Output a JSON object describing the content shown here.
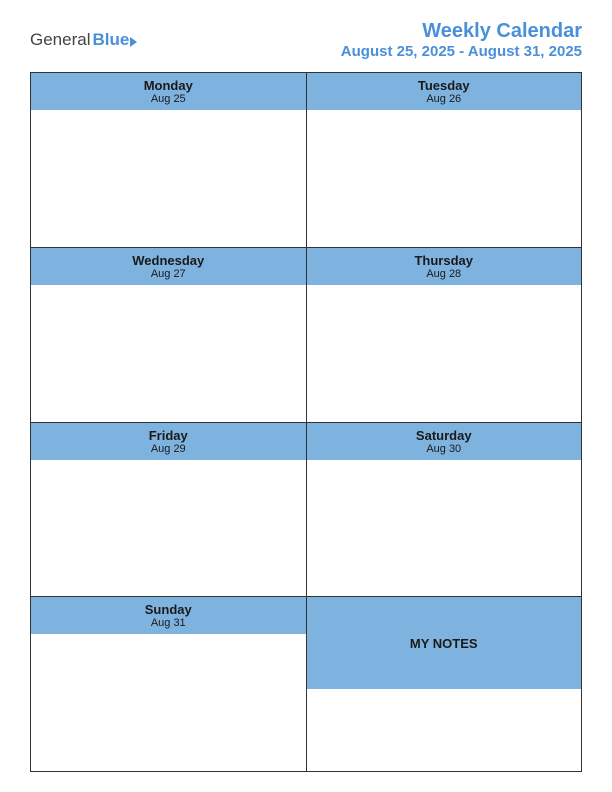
{
  "header": {
    "logo": {
      "general": "General",
      "blue": "Blue"
    },
    "title": "Weekly Calendar",
    "date_range": "August 25, 2025 - August 31, 2025"
  },
  "calendar": {
    "rows": [
      {
        "cells": [
          {
            "day": "Monday",
            "date": "Aug 25"
          },
          {
            "day": "Tuesday",
            "date": "Aug 26"
          }
        ]
      },
      {
        "cells": [
          {
            "day": "Wednesday",
            "date": "Aug 27"
          },
          {
            "day": "Thursday",
            "date": "Aug 28"
          }
        ]
      },
      {
        "cells": [
          {
            "day": "Friday",
            "date": "Aug 29"
          },
          {
            "day": "Saturday",
            "date": "Aug 30"
          }
        ]
      },
      {
        "cells": [
          {
            "day": "Sunday",
            "date": "Aug 31"
          },
          {
            "day": "MY NOTES",
            "date": ""
          }
        ]
      }
    ]
  }
}
